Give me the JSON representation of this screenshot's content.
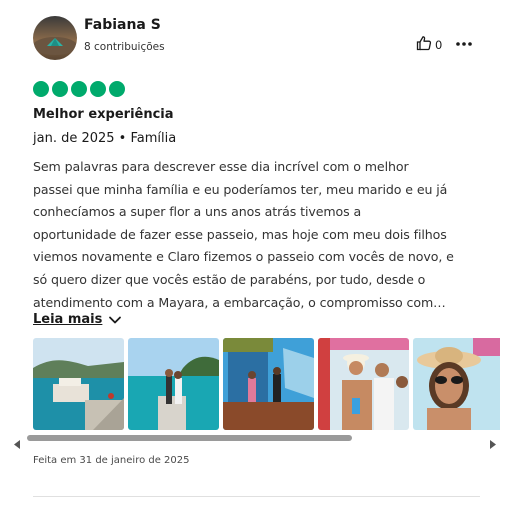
{
  "reviewer": {
    "name": "Fabiana S",
    "contributions": "8 contribuições"
  },
  "actions": {
    "like_count": "0",
    "like_icon": "thumbs-up-icon",
    "more_icon": "more-options-icon"
  },
  "review": {
    "rating": 5,
    "rating_color": "#00aa6c",
    "title": "Melhor experiência",
    "meta": "jan. de 2025 • Família",
    "body_lines": [
      "Sem palavras para descrever esse dia incrível com o melhor",
      "passei que minha família e eu poderíamos ter, meu marido e eu já",
      "conhecíamos a super flor a uns anos atrás tivemos a",
      "oportunidade de fazer esse passeio, mas hoje com meu dois filhos",
      "viemos novamente e Claro fizemos o passeio com vocês de novo, e",
      "só quero dizer que vocês estão de parabéns, por tudo, desde o",
      "atendimento com a Mayara, a embarcação, o compromisso com…"
    ],
    "read_more": "Leia mais",
    "written_date": "Feita em 31 de janeiro de 2025"
  },
  "photos": [
    {
      "name": "photo-boat-harbor"
    },
    {
      "name": "photo-people-on-pier"
    },
    {
      "name": "photo-boat-deck"
    },
    {
      "name": "photo-group-on-boat"
    },
    {
      "name": "photo-woman-with-hat"
    }
  ]
}
